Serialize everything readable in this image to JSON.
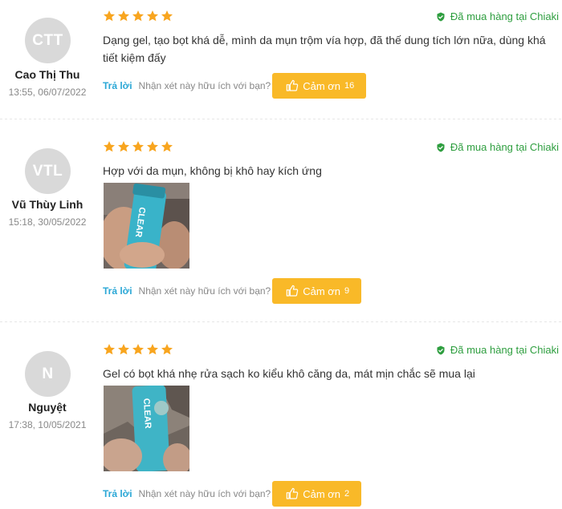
{
  "colors": {
    "star": "#f8a51f",
    "verified": "#2e9e3f",
    "thanks_button": "#f9b928",
    "reply_link": "#2aa7d6",
    "avatar_bg": "#d9d9d9"
  },
  "common": {
    "verified_label": "Đã mua hàng tại Chiaki",
    "reply_label": "Trả lời",
    "helpful_question": "Nhận xét này hữu ích với bạn?",
    "thanks_label": "Cảm ơn"
  },
  "reviews": [
    {
      "initials": "CTT",
      "name": "Cao Thị Thu",
      "time": "13:55, 06/07/2022",
      "stars": 5,
      "comment": "Dạng gel, tạo bọt khá dễ, mình da mụn trộm vía hợp, đã thế dung tích lớn nữa, dùng khá tiết kiệm đấy",
      "thanks_count": "16",
      "has_photo": false
    },
    {
      "initials": "VTL",
      "name": "Vũ Thùy Linh",
      "time": "15:18, 30/05/2022",
      "stars": 5,
      "comment": "Hợp với da mụn, không bị khô hay kích ứng",
      "thanks_count": "9",
      "has_photo": true,
      "photo_text": "CLEAR"
    },
    {
      "initials": "N",
      "name": "Nguyệt",
      "time": "17:38, 10/05/2021",
      "stars": 5,
      "comment": "Gel có bọt khá nhẹ rửa sạch ko kiểu khô căng da, mát mịn chắc sẽ mua lại",
      "thanks_count": "2",
      "has_photo": true,
      "photo_text": "CLEAR"
    }
  ]
}
